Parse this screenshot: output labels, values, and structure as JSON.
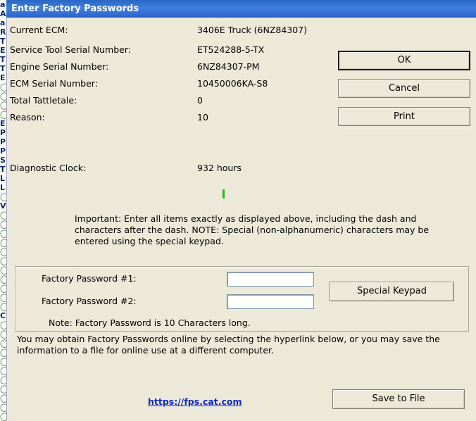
{
  "window": {
    "title": "Enter Factory Passwords"
  },
  "background_strip": {
    "cells": [
      {
        "t": "a",
        "icon": false
      },
      {
        "t": "A",
        "icon": false
      },
      {
        "t": "a",
        "icon": false
      },
      {
        "t": "R",
        "icon": false
      },
      {
        "t": "T",
        "icon": false
      },
      {
        "t": "E",
        "icon": false
      },
      {
        "t": "T",
        "icon": false
      },
      {
        "t": "T",
        "icon": false
      },
      {
        "t": "E",
        "icon": false
      },
      {
        "t": "",
        "icon": true
      },
      {
        "t": "",
        "icon": true
      },
      {
        "t": "",
        "icon": true
      },
      {
        "t": "",
        "icon": true
      },
      {
        "t": "E",
        "icon": false
      },
      {
        "t": "P",
        "icon": false
      },
      {
        "t": "P",
        "icon": false
      },
      {
        "t": "P",
        "icon": false
      },
      {
        "t": "S",
        "icon": false
      },
      {
        "t": "T",
        "icon": false
      },
      {
        "t": "L",
        "icon": false
      },
      {
        "t": "L",
        "icon": false
      },
      {
        "t": "",
        "icon": true
      },
      {
        "t": "V",
        "icon": false
      },
      {
        "t": "",
        "icon": true
      },
      {
        "t": "",
        "icon": true
      },
      {
        "t": "",
        "icon": true
      },
      {
        "t": "",
        "icon": true
      },
      {
        "t": "",
        "icon": true
      },
      {
        "t": "",
        "icon": true
      },
      {
        "t": "",
        "icon": true
      },
      {
        "t": "",
        "icon": true
      },
      {
        "t": "",
        "icon": true
      },
      {
        "t": "",
        "icon": true
      },
      {
        "t": "",
        "icon": true
      },
      {
        "t": "C",
        "icon": false
      },
      {
        "t": "",
        "icon": true
      },
      {
        "t": "",
        "icon": true
      },
      {
        "t": "",
        "icon": true
      },
      {
        "t": "",
        "icon": true
      },
      {
        "t": "",
        "icon": true
      },
      {
        "t": "",
        "icon": true
      },
      {
        "t": "",
        "icon": true
      },
      {
        "t": "",
        "icon": true
      },
      {
        "t": "",
        "icon": true
      },
      {
        "t": "",
        "icon": true
      },
      {
        "t": "",
        "icon": true
      }
    ]
  },
  "ecm_info": {
    "current_ecm_label": "Current ECM:",
    "current_ecm_value": "3406E Truck (6NZ84307)",
    "service_tool_label": "Service Tool Serial Number:",
    "service_tool_value": "ET524288-5-TX",
    "engine_serial_label": "Engine Serial Number:",
    "engine_serial_value": "6NZ84307-PM",
    "ecm_serial_label": "ECM Serial Number:",
    "ecm_serial_value": "10450006KA-S8",
    "tattletale_label": "Total Tattletale:",
    "tattletale_value": "0",
    "reason_label": "Reason:",
    "reason_value": "10",
    "diag_clock_label": "Diagnostic Clock:",
    "diag_clock_value": "932 hours"
  },
  "buttons": {
    "ok": "OK",
    "cancel": "Cancel",
    "print": "Print",
    "special_keypad": "Special Keypad",
    "save_to_file": "Save to File"
  },
  "important_note": "Important: Enter all items exactly as displayed above, including the dash and characters after the dash.  NOTE: Special (non-alphanumeric) characters may be entered using the special keypad.",
  "passwords": {
    "pw1_label": "Factory Password #1:",
    "pw1_value": "",
    "pw2_label": "Factory Password #2:",
    "pw2_value": "",
    "length_note": "Note: Factory Password is 10 Characters long."
  },
  "online_info": "You may obtain Factory Passwords online by selecting the hyperlink below, or you may save the information to a file for online use at a different computer.",
  "link": "https://fps.cat.com",
  "colors": {
    "title_bar": "#2a67c4",
    "dialog_bg": "#ece9d8",
    "link": "#0a2abe",
    "indicator": "#19c219"
  }
}
